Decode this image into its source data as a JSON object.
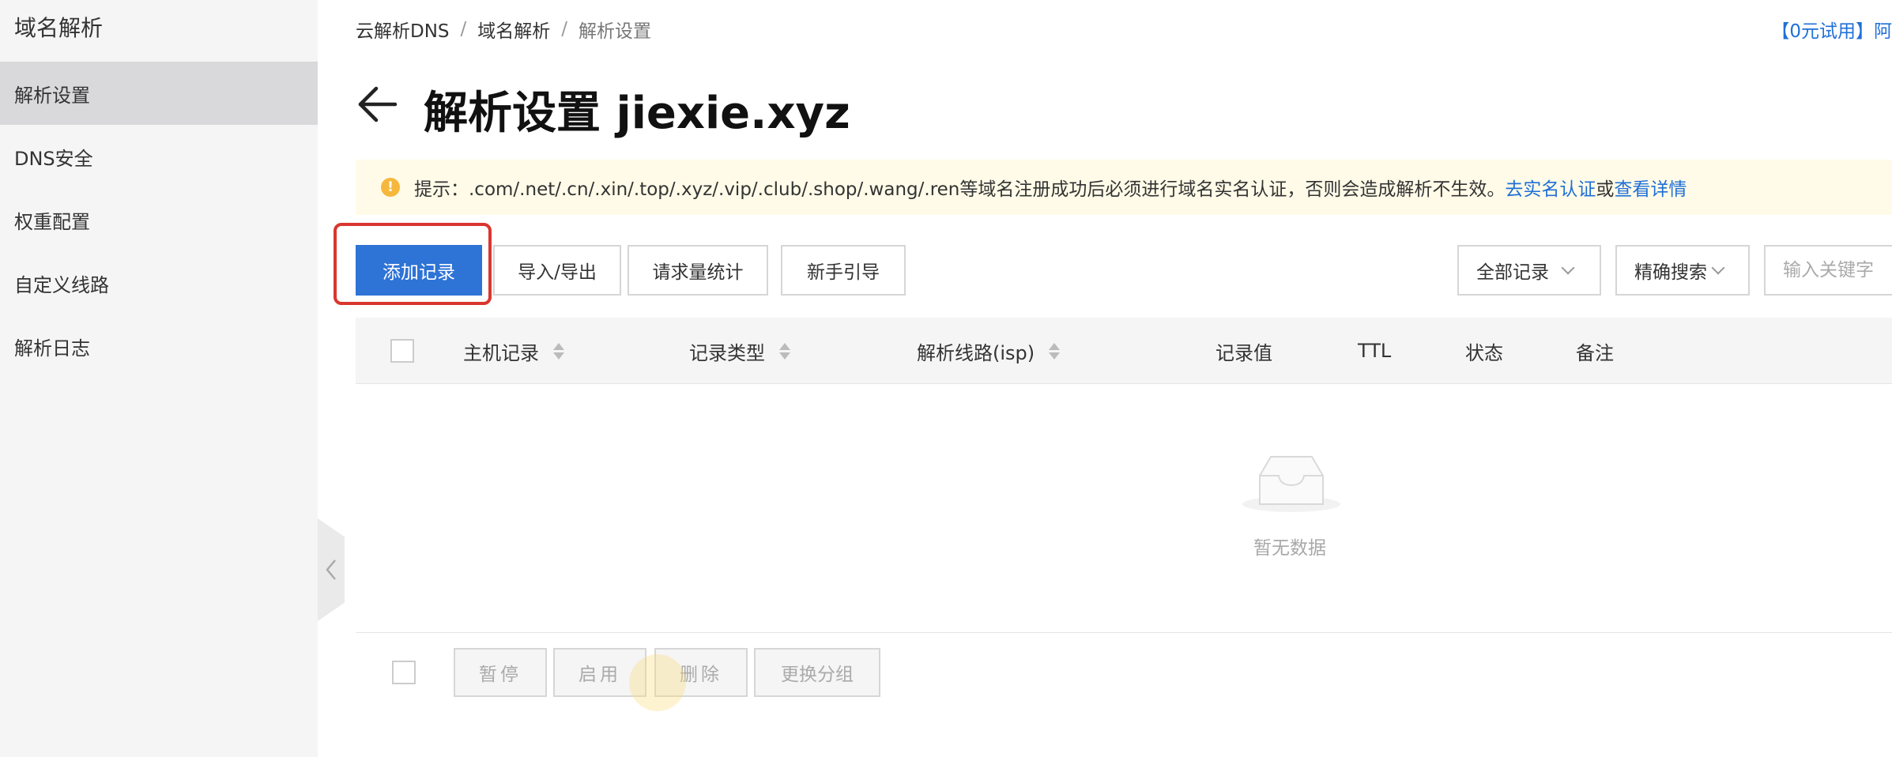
{
  "sidebar": {
    "title": "域名解析",
    "items": [
      {
        "label": "解析设置",
        "active": true
      },
      {
        "label": "DNS安全"
      },
      {
        "label": "权重配置"
      },
      {
        "label": "自定义线路"
      },
      {
        "label": "解析日志"
      }
    ]
  },
  "breadcrumb": [
    "云解析DNS",
    "域名解析",
    "解析设置"
  ],
  "breadcrumb_sep": "/",
  "top_link": "【0元试用】阿",
  "page": {
    "title": "解析设置 jiexie.xyz"
  },
  "notice": {
    "prefix": "提示：.com/.net/.cn/.xin/.top/.xyz/.vip/.club/.shop/.wang/.ren等域名注册成功后必须进行域名实名认证，否则会造成解析不生效。",
    "link1": "去实名认证",
    "middle": "或",
    "link2": "查看详情"
  },
  "toolbar": {
    "add_record": "添加记录",
    "import_export": "导入/导出",
    "request_stats": "请求量统计",
    "guide": "新手引导",
    "filter_select": "全部记录",
    "search_mode": "精确搜索",
    "keyword_placeholder": "输入关键字"
  },
  "table": {
    "columns": [
      "主机记录",
      "记录类型",
      "解析线路(isp)",
      "记录值",
      "TTL",
      "状态",
      "备注"
    ],
    "empty_text": "暂无数据"
  },
  "bulk_actions": {
    "pause": "暂停",
    "enable": "启用",
    "delete": "删除",
    "change_group": "更换分组"
  },
  "colors": {
    "primary": "#2e73d6",
    "link": "#1f6fd8",
    "highlight": "#d9362f",
    "notice_bg": "#fffbe8",
    "notice_icon": "#f5b83d"
  },
  "icons": {
    "back": "arrow-left-icon",
    "collapse": "chevron-left-icon",
    "notice": "info-icon",
    "sort": "sort-icon",
    "empty": "empty-inbox-icon"
  }
}
